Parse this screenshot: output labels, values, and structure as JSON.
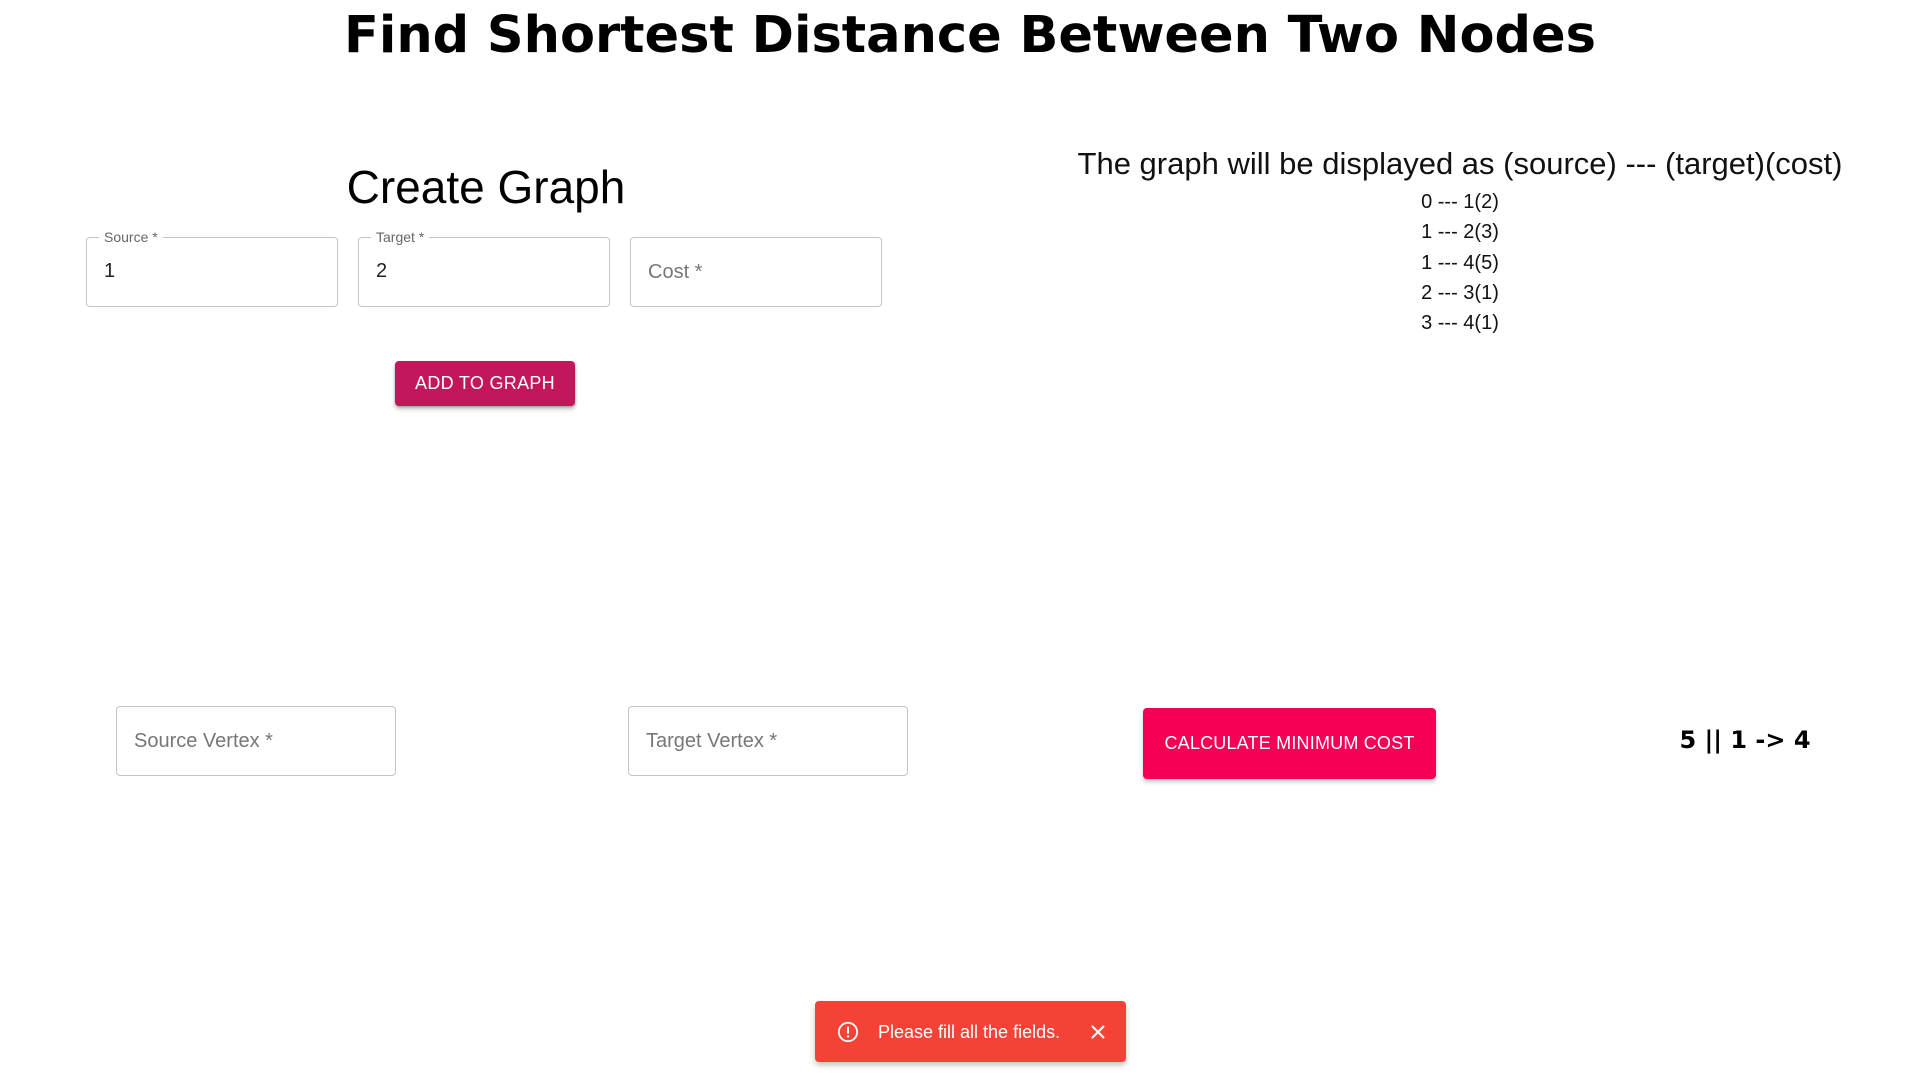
{
  "page": {
    "title": "Find Shortest Distance Between Two Nodes"
  },
  "create_graph": {
    "title": "Create Graph",
    "source": {
      "label": "Source *",
      "value": "1"
    },
    "target": {
      "label": "Target *",
      "value": "2"
    },
    "cost": {
      "placeholder": "Cost *",
      "value": ""
    },
    "add_button_label": "ADD TO GRAPH"
  },
  "graph_display": {
    "heading": "The graph will be displayed as (source) --- (target)(cost)",
    "edges": [
      "0 --- 1(2)",
      "1 --- 2(3)",
      "1 --- 4(5)",
      "2 --- 3(1)",
      "3 --- 4(1)"
    ]
  },
  "query": {
    "source_vertex": {
      "placeholder": "Source Vertex *",
      "value": ""
    },
    "target_vertex": {
      "placeholder": "Target Vertex *",
      "value": ""
    },
    "calculate_button_label": "CALCULATE MINIMUM COST",
    "result": "5 || 1 -> 4"
  },
  "snackbar": {
    "message": "Please fill all the fields.",
    "icon": "error-outline-icon",
    "close_icon": "close-icon"
  },
  "colors": {
    "add_button": "#c2185b",
    "calculate_button": "#f50057",
    "snackbar_error": "#f44336"
  }
}
